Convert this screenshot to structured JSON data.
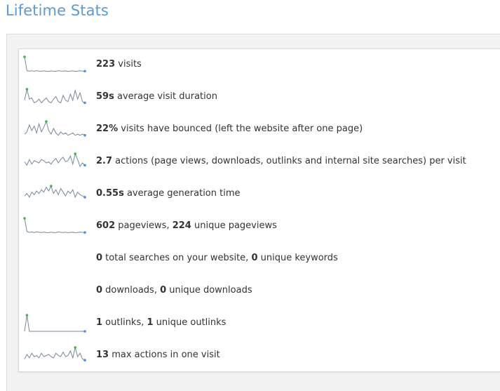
{
  "title": "Lifetime Stats",
  "colors": {
    "title": "#5b9bd5",
    "sparkline_line": "#7a8799",
    "sparkline_max": "#3fb34f",
    "sparkline_end": "#4a90e2"
  },
  "rows": [
    {
      "parts": [
        {
          "v": "223",
          "b": true
        },
        {
          "v": " visits",
          "b": false
        }
      ],
      "spark": [
        14,
        2,
        1.6,
        2,
        1.5,
        2,
        1.7,
        1.5,
        1.9,
        1.6,
        1.4,
        1.8,
        1.6,
        1.5,
        2,
        1.7,
        1.6,
        1.9,
        1.4,
        1.7,
        1.8,
        1.5,
        1.6,
        2,
        1.7,
        1.6
      ],
      "max_index": 0,
      "show": true
    },
    {
      "parts": [
        {
          "v": "59s",
          "b": true
        },
        {
          "v": " average visit duration",
          "b": false
        }
      ],
      "spark": [
        4,
        13,
        5,
        6,
        2,
        3,
        5,
        2,
        4,
        6,
        3,
        2,
        5,
        7,
        3,
        2,
        8,
        4,
        3,
        9,
        4,
        12,
        5,
        10,
        3,
        2
      ],
      "max_index": 1,
      "show": true
    },
    {
      "parts": [
        {
          "v": "22%",
          "b": true
        },
        {
          "v": " visits have bounced (left the website after one page)",
          "b": false
        }
      ],
      "spark": [
        3,
        5,
        11,
        6,
        10,
        4,
        12,
        5,
        9,
        14,
        6,
        3,
        8,
        4,
        2,
        5,
        3,
        4,
        2,
        3,
        4,
        2,
        3,
        2,
        3,
        2
      ],
      "max_index": 9,
      "show": true
    },
    {
      "parts": [
        {
          "v": "2.7",
          "b": true
        },
        {
          "v": " actions (page views, downloads, outlinks and internal site searches) per visit",
          "b": false
        }
      ],
      "spark": [
        7,
        4,
        9,
        5,
        8,
        7,
        6,
        9,
        8,
        6,
        7,
        5,
        8,
        10,
        6,
        9,
        11,
        7,
        8,
        12,
        5,
        14,
        9,
        3,
        6,
        4
      ],
      "max_index": 21,
      "show": true
    },
    {
      "parts": [
        {
          "v": "0.55s",
          "b": true
        },
        {
          "v": " average generation time",
          "b": false
        }
      ],
      "spark": [
        5,
        7,
        4,
        8,
        6,
        9,
        7,
        10,
        8,
        12,
        9,
        13,
        7,
        10,
        6,
        11,
        8,
        5,
        9,
        7,
        10,
        4,
        8,
        6,
        5,
        4
      ],
      "max_index": 11,
      "show": true
    },
    {
      "parts": [
        {
          "v": "602",
          "b": true
        },
        {
          "v": " pageviews, ",
          "b": false
        },
        {
          "v": "224",
          "b": true
        },
        {
          "v": " unique pageviews",
          "b": false
        }
      ],
      "spark": [
        14,
        2.5,
        1.8,
        2.2,
        1.6,
        2.4,
        1.9,
        1.6,
        2.1,
        1.7,
        1.5,
        2,
        1.7,
        1.6,
        2.2,
        1.8,
        1.7,
        2,
        1.5,
        1.8,
        1.9,
        1.6,
        1.7,
        2.1,
        1.8,
        1.7
      ],
      "max_index": 0,
      "show": true
    },
    {
      "parts": [
        {
          "v": "0",
          "b": true
        },
        {
          "v": " total searches on your website, ",
          "b": false
        },
        {
          "v": "0",
          "b": true
        },
        {
          "v": " unique keywords",
          "b": false
        }
      ],
      "spark": [],
      "max_index": 0,
      "show": false
    },
    {
      "parts": [
        {
          "v": "0",
          "b": true
        },
        {
          "v": " downloads, ",
          "b": false
        },
        {
          "v": "0",
          "b": true
        },
        {
          "v": " unique downloads",
          "b": false
        }
      ],
      "spark": [],
      "max_index": 0,
      "show": false
    },
    {
      "parts": [
        {
          "v": "1",
          "b": true
        },
        {
          "v": " outlinks, ",
          "b": false
        },
        {
          "v": "1",
          "b": true
        },
        {
          "v": " unique outlinks",
          "b": false
        }
      ],
      "spark": [
        0,
        14,
        0,
        0,
        0,
        0,
        0,
        0,
        0,
        0,
        0,
        0,
        0,
        0,
        0,
        0,
        0,
        0,
        0,
        0,
        0,
        0,
        0,
        0,
        0,
        0
      ],
      "max_index": 1,
      "show": true
    },
    {
      "parts": [
        {
          "v": "13",
          "b": true
        },
        {
          "v": " max actions in one visit",
          "b": false
        }
      ],
      "spark": [
        4,
        8,
        5,
        9,
        6,
        7,
        5,
        9,
        6,
        7,
        8,
        6,
        5,
        9,
        7,
        6,
        10,
        6,
        7,
        11,
        5,
        14,
        6,
        9,
        4,
        3
      ],
      "max_index": 21,
      "show": true
    }
  ]
}
